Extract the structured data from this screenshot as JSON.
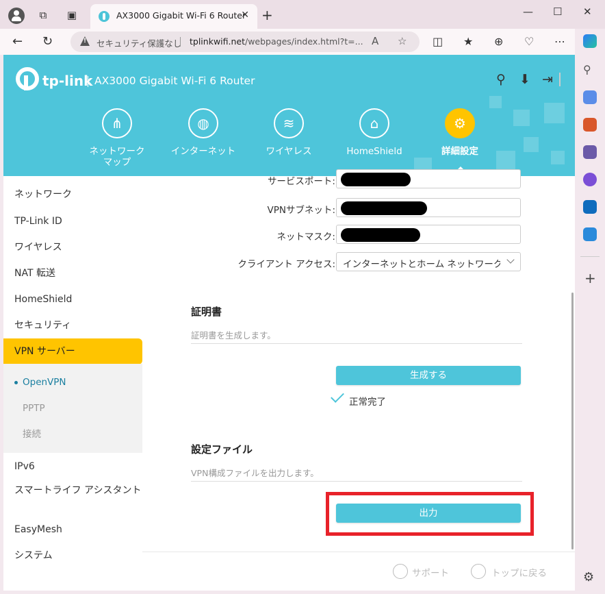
{
  "browser": {
    "tab_title": "AX3000 Gigabit Wi-Fi 6 Router",
    "tab_close": "✕",
    "new_tab": "+",
    "security_label": "セキュリティ保護なし",
    "url_host": "tplinkwifi.net",
    "url_path": "/webpages/index.html?t=..."
  },
  "header": {
    "brand": "tp-link",
    "title": "AX3000 Gigabit Wi-Fi 6 Router"
  },
  "nav": [
    {
      "label": "ネットワーク\nマップ",
      "icon": "network-map-icon"
    },
    {
      "label": "インターネット",
      "icon": "globe-icon"
    },
    {
      "label": "ワイヤレス",
      "icon": "wifi-icon"
    },
    {
      "label": "HomeShield",
      "icon": "homeshield-icon"
    },
    {
      "label": "詳細設定",
      "icon": "gear-icon",
      "active": true
    }
  ],
  "sidebar": {
    "items": [
      "ネットワーク",
      "TP-Link ID",
      "ワイヤレス",
      "NAT 転送",
      "HomeShield",
      "セキュリティ",
      "VPN サーバー"
    ],
    "sub_items": [
      "OpenVPN",
      "PPTP",
      "接続"
    ],
    "items_after": [
      "IPv6",
      "スマートライフ アシスタント",
      "EasyMesh",
      "システム"
    ]
  },
  "form": {
    "service_port_label": "サービスポート:",
    "vpn_subnet_label": "VPNサブネット:",
    "netmask_label": "ネットマスク:",
    "client_access_label": "クライアント アクセス:",
    "client_access_value": "インターネットとホーム ネットワーク"
  },
  "certificate": {
    "title": "証明書",
    "desc": "証明書を生成します。",
    "button": "生成する",
    "status": "正常完了"
  },
  "config_file": {
    "title": "設定ファイル",
    "desc": "VPN構成ファイルを出力します。",
    "button": "出力"
  },
  "footer": {
    "support": "サポート",
    "back_to_top": "トップに戻る"
  },
  "colors": {
    "brand": "#4ec5da",
    "active": "#ffc400",
    "highlight": "#e8222a"
  }
}
